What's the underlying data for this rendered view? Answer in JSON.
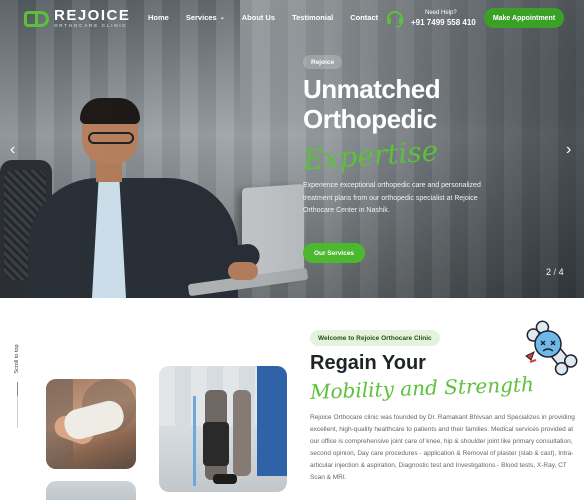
{
  "brand": {
    "name": "REJOICE",
    "subtitle": "ORTHOCARE CLINIC",
    "accent": "#4cb82f"
  },
  "nav": {
    "items": [
      {
        "label": "Home",
        "has_dropdown": false
      },
      {
        "label": "Services",
        "has_dropdown": true
      },
      {
        "label": "About Us",
        "has_dropdown": false
      },
      {
        "label": "Testimonial",
        "has_dropdown": false
      },
      {
        "label": "Contact",
        "has_dropdown": false
      }
    ]
  },
  "help": {
    "label": "Need Help?",
    "phone": "+91 7499 558 410",
    "icon": "headset-icon"
  },
  "cta": {
    "label": "Make Appointment"
  },
  "hero": {
    "tag": "Rejoice",
    "title_line1": "Unmatched",
    "title_line2": "Orthopedic",
    "title_script": "Expertise",
    "description": "Experience exceptional orthopedic care and personalized treatment plans from our orthopedic specialist at Rejoice Orthocare Center in Nashik.",
    "button": "Our Services",
    "slide_current": "2",
    "slide_separator": "/",
    "slide_total": "4"
  },
  "scroll": {
    "label": "Scroll to top"
  },
  "about": {
    "badge": "Welcome to Rejoice Orthocare Clinic",
    "heading": "Regain Your",
    "heading_script": "Mobility and Strength",
    "paragraph": "Rejoice Orthocare clinic was founded by Dr. Ramakant Bhivsan and Specializes in providing excellent, high-quality healthcare to patients and their families. Medical services provided at our office is comprehensive joint care of knee, hip & shoulder joint like primary consultation, second opinion, Day care procedures - application & Removal of plaster (slab & cast), Intra-articular injection & aspiration, Diagnostic test and Investigations - Blood tests, X-Ray, CT Scan & MRI."
  }
}
